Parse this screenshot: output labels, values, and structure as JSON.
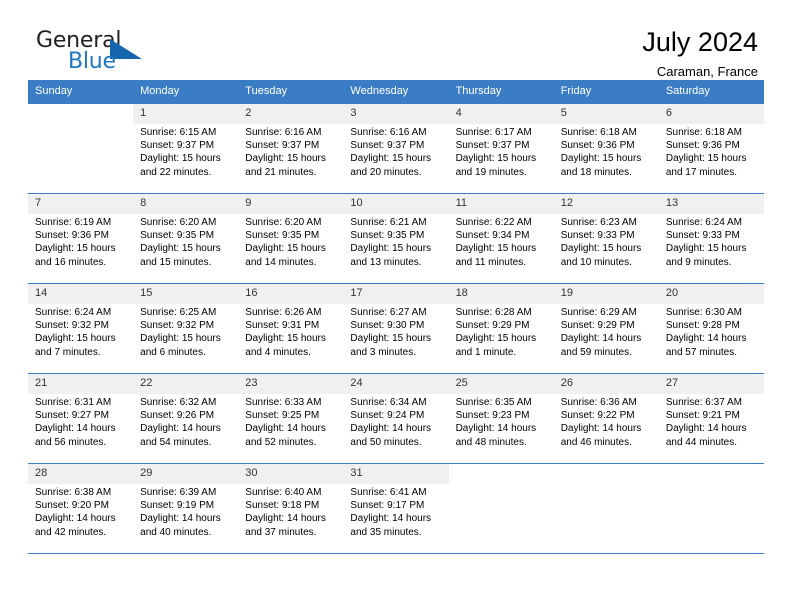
{
  "brand": {
    "name_part1": "General",
    "name_part2": "Blue"
  },
  "header": {
    "title": "July 2024",
    "location": "Caraman, France"
  },
  "calendar": {
    "weekday_headers": [
      "Sunday",
      "Monday",
      "Tuesday",
      "Wednesday",
      "Thursday",
      "Friday",
      "Saturday"
    ],
    "accent_color": "#3b7dc4",
    "daynum_background": "#f0f0f0",
    "weeks": [
      [
        {
          "day": "",
          "sunrise": "",
          "sunset": "",
          "daylight_line1": "",
          "daylight_line2": ""
        },
        {
          "day": "1",
          "sunrise": "Sunrise: 6:15 AM",
          "sunset": "Sunset: 9:37 PM",
          "daylight_line1": "Daylight: 15 hours",
          "daylight_line2": "and 22 minutes."
        },
        {
          "day": "2",
          "sunrise": "Sunrise: 6:16 AM",
          "sunset": "Sunset: 9:37 PM",
          "daylight_line1": "Daylight: 15 hours",
          "daylight_line2": "and 21 minutes."
        },
        {
          "day": "3",
          "sunrise": "Sunrise: 6:16 AM",
          "sunset": "Sunset: 9:37 PM",
          "daylight_line1": "Daylight: 15 hours",
          "daylight_line2": "and 20 minutes."
        },
        {
          "day": "4",
          "sunrise": "Sunrise: 6:17 AM",
          "sunset": "Sunset: 9:37 PM",
          "daylight_line1": "Daylight: 15 hours",
          "daylight_line2": "and 19 minutes."
        },
        {
          "day": "5",
          "sunrise": "Sunrise: 6:18 AM",
          "sunset": "Sunset: 9:36 PM",
          "daylight_line1": "Daylight: 15 hours",
          "daylight_line2": "and 18 minutes."
        },
        {
          "day": "6",
          "sunrise": "Sunrise: 6:18 AM",
          "sunset": "Sunset: 9:36 PM",
          "daylight_line1": "Daylight: 15 hours",
          "daylight_line2": "and 17 minutes."
        }
      ],
      [
        {
          "day": "7",
          "sunrise": "Sunrise: 6:19 AM",
          "sunset": "Sunset: 9:36 PM",
          "daylight_line1": "Daylight: 15 hours",
          "daylight_line2": "and 16 minutes."
        },
        {
          "day": "8",
          "sunrise": "Sunrise: 6:20 AM",
          "sunset": "Sunset: 9:35 PM",
          "daylight_line1": "Daylight: 15 hours",
          "daylight_line2": "and 15 minutes."
        },
        {
          "day": "9",
          "sunrise": "Sunrise: 6:20 AM",
          "sunset": "Sunset: 9:35 PM",
          "daylight_line1": "Daylight: 15 hours",
          "daylight_line2": "and 14 minutes."
        },
        {
          "day": "10",
          "sunrise": "Sunrise: 6:21 AM",
          "sunset": "Sunset: 9:35 PM",
          "daylight_line1": "Daylight: 15 hours",
          "daylight_line2": "and 13 minutes."
        },
        {
          "day": "11",
          "sunrise": "Sunrise: 6:22 AM",
          "sunset": "Sunset: 9:34 PM",
          "daylight_line1": "Daylight: 15 hours",
          "daylight_line2": "and 11 minutes."
        },
        {
          "day": "12",
          "sunrise": "Sunrise: 6:23 AM",
          "sunset": "Sunset: 9:33 PM",
          "daylight_line1": "Daylight: 15 hours",
          "daylight_line2": "and 10 minutes."
        },
        {
          "day": "13",
          "sunrise": "Sunrise: 6:24 AM",
          "sunset": "Sunset: 9:33 PM",
          "daylight_line1": "Daylight: 15 hours",
          "daylight_line2": "and 9 minutes."
        }
      ],
      [
        {
          "day": "14",
          "sunrise": "Sunrise: 6:24 AM",
          "sunset": "Sunset: 9:32 PM",
          "daylight_line1": "Daylight: 15 hours",
          "daylight_line2": "and 7 minutes."
        },
        {
          "day": "15",
          "sunrise": "Sunrise: 6:25 AM",
          "sunset": "Sunset: 9:32 PM",
          "daylight_line1": "Daylight: 15 hours",
          "daylight_line2": "and 6 minutes."
        },
        {
          "day": "16",
          "sunrise": "Sunrise: 6:26 AM",
          "sunset": "Sunset: 9:31 PM",
          "daylight_line1": "Daylight: 15 hours",
          "daylight_line2": "and 4 minutes."
        },
        {
          "day": "17",
          "sunrise": "Sunrise: 6:27 AM",
          "sunset": "Sunset: 9:30 PM",
          "daylight_line1": "Daylight: 15 hours",
          "daylight_line2": "and 3 minutes."
        },
        {
          "day": "18",
          "sunrise": "Sunrise: 6:28 AM",
          "sunset": "Sunset: 9:29 PM",
          "daylight_line1": "Daylight: 15 hours",
          "daylight_line2": "and 1 minute."
        },
        {
          "day": "19",
          "sunrise": "Sunrise: 6:29 AM",
          "sunset": "Sunset: 9:29 PM",
          "daylight_line1": "Daylight: 14 hours",
          "daylight_line2": "and 59 minutes."
        },
        {
          "day": "20",
          "sunrise": "Sunrise: 6:30 AM",
          "sunset": "Sunset: 9:28 PM",
          "daylight_line1": "Daylight: 14 hours",
          "daylight_line2": "and 57 minutes."
        }
      ],
      [
        {
          "day": "21",
          "sunrise": "Sunrise: 6:31 AM",
          "sunset": "Sunset: 9:27 PM",
          "daylight_line1": "Daylight: 14 hours",
          "daylight_line2": "and 56 minutes."
        },
        {
          "day": "22",
          "sunrise": "Sunrise: 6:32 AM",
          "sunset": "Sunset: 9:26 PM",
          "daylight_line1": "Daylight: 14 hours",
          "daylight_line2": "and 54 minutes."
        },
        {
          "day": "23",
          "sunrise": "Sunrise: 6:33 AM",
          "sunset": "Sunset: 9:25 PM",
          "daylight_line1": "Daylight: 14 hours",
          "daylight_line2": "and 52 minutes."
        },
        {
          "day": "24",
          "sunrise": "Sunrise: 6:34 AM",
          "sunset": "Sunset: 9:24 PM",
          "daylight_line1": "Daylight: 14 hours",
          "daylight_line2": "and 50 minutes."
        },
        {
          "day": "25",
          "sunrise": "Sunrise: 6:35 AM",
          "sunset": "Sunset: 9:23 PM",
          "daylight_line1": "Daylight: 14 hours",
          "daylight_line2": "and 48 minutes."
        },
        {
          "day": "26",
          "sunrise": "Sunrise: 6:36 AM",
          "sunset": "Sunset: 9:22 PM",
          "daylight_line1": "Daylight: 14 hours",
          "daylight_line2": "and 46 minutes."
        },
        {
          "day": "27",
          "sunrise": "Sunrise: 6:37 AM",
          "sunset": "Sunset: 9:21 PM",
          "daylight_line1": "Daylight: 14 hours",
          "daylight_line2": "and 44 minutes."
        }
      ],
      [
        {
          "day": "28",
          "sunrise": "Sunrise: 6:38 AM",
          "sunset": "Sunset: 9:20 PM",
          "daylight_line1": "Daylight: 14 hours",
          "daylight_line2": "and 42 minutes."
        },
        {
          "day": "29",
          "sunrise": "Sunrise: 6:39 AM",
          "sunset": "Sunset: 9:19 PM",
          "daylight_line1": "Daylight: 14 hours",
          "daylight_line2": "and 40 minutes."
        },
        {
          "day": "30",
          "sunrise": "Sunrise: 6:40 AM",
          "sunset": "Sunset: 9:18 PM",
          "daylight_line1": "Daylight: 14 hours",
          "daylight_line2": "and 37 minutes."
        },
        {
          "day": "31",
          "sunrise": "Sunrise: 6:41 AM",
          "sunset": "Sunset: 9:17 PM",
          "daylight_line1": "Daylight: 14 hours",
          "daylight_line2": "and 35 minutes."
        },
        {
          "day": "",
          "sunrise": "",
          "sunset": "",
          "daylight_line1": "",
          "daylight_line2": ""
        },
        {
          "day": "",
          "sunrise": "",
          "sunset": "",
          "daylight_line1": "",
          "daylight_line2": ""
        },
        {
          "day": "",
          "sunrise": "",
          "sunset": "",
          "daylight_line1": "",
          "daylight_line2": ""
        }
      ]
    ]
  }
}
